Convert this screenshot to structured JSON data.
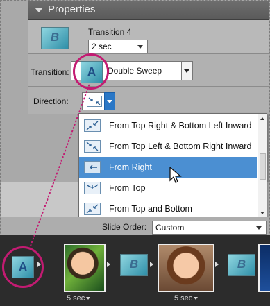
{
  "properties": {
    "header": "Properties",
    "transition_name": "Transition 4",
    "thumb_letter": "B",
    "duration_value": "2 sec"
  },
  "transition_row": {
    "label": "Transition:",
    "value": "Double Sweep",
    "icon_letter": "A"
  },
  "direction_row": {
    "label": "Direction:"
  },
  "dropdown": {
    "items": [
      {
        "label": "From Top Right & Bottom Left Inward",
        "selected": false
      },
      {
        "label": "From Top Left & Bottom Right Inward",
        "selected": false
      },
      {
        "label": "From Right",
        "selected": true
      },
      {
        "label": "From Top",
        "selected": false
      },
      {
        "label": "From Top and Bottom",
        "selected": false
      }
    ]
  },
  "slide_order": {
    "label": "Slide Order:",
    "value": "Custom"
  },
  "filmstrip": {
    "transition_letter_left": "A",
    "transition_letter": "B",
    "slide1_duration": "5 sec",
    "slide2_duration": "5 sec"
  },
  "colors": {
    "callout": "#c31b72",
    "selection": "#4b8fd2"
  }
}
